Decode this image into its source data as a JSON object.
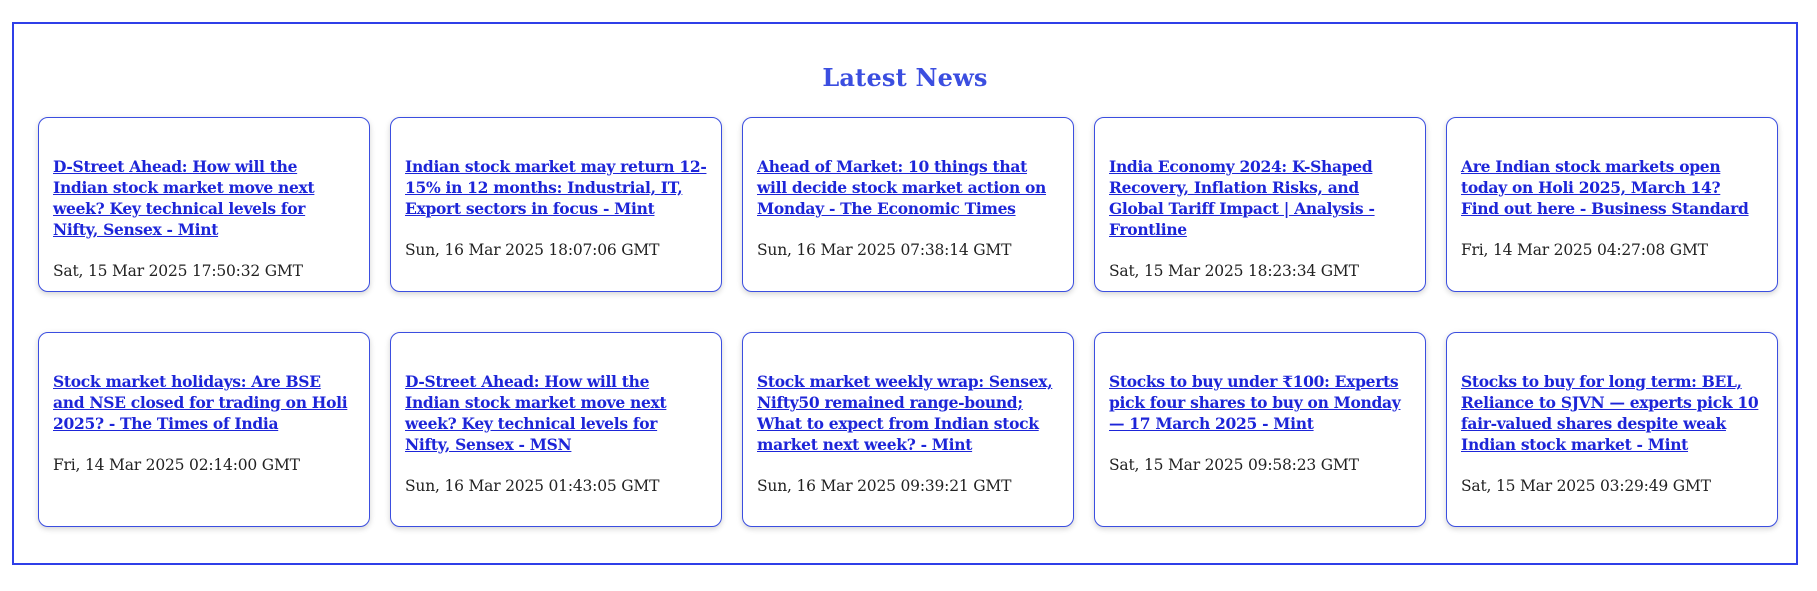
{
  "section": {
    "title": "Latest News"
  },
  "news": {
    "items": [
      {
        "title": "D-Street Ahead: How will the Indian stock market move next week? Key technical levels for Nifty, Sensex - Mint",
        "date": "Sat, 15 Mar 2025 17:50:32 GMT"
      },
      {
        "title": "Indian stock market may return 12-15% in 12 months: Industrial, IT, Export sectors in focus - Mint",
        "date": "Sun, 16 Mar 2025 18:07:06 GMT"
      },
      {
        "title": "Ahead of Market: 10 things that will decide stock market action on Monday - The Economic Times",
        "date": "Sun, 16 Mar 2025 07:38:14 GMT"
      },
      {
        "title": "India Economy 2024: K-Shaped Recovery, Inflation Risks, and Global Tariff Impact | Analysis - Frontline",
        "date": "Sat, 15 Mar 2025 18:23:34 GMT"
      },
      {
        "title": "Are Indian stock markets open today on Holi 2025, March 14? Find out here - Business Standard",
        "date": "Fri, 14 Mar 2025 04:27:08 GMT"
      },
      {
        "title": "Stock market holidays: Are BSE and NSE closed for trading on Holi 2025? - The Times of India",
        "date": "Fri, 14 Mar 2025 02:14:00 GMT"
      },
      {
        "title": "D-Street Ahead: How will the Indian stock market move next week? Key technical levels for Nifty, Sensex - MSN",
        "date": "Sun, 16 Mar 2025 01:43:05 GMT"
      },
      {
        "title": "Stock market weekly wrap: Sensex, Nifty50 remained range-bound; What to expect from Indian stock market next week? - Mint",
        "date": "Sun, 16 Mar 2025 09:39:21 GMT"
      },
      {
        "title": "Stocks to buy under ₹100: Experts pick four shares to buy on Monday — 17 March 2025 - Mint",
        "date": "Sat, 15 Mar 2025 09:58:23 GMT"
      },
      {
        "title": "Stocks to buy for long term: BEL, Reliance to SJVN — experts pick 10 fair-valued shares despite weak Indian stock market - Mint",
        "date": "Sat, 15 Mar 2025 03:29:49 GMT"
      }
    ]
  },
  "colors": {
    "accent": "#3b4ee0",
    "link": "#1d25d8",
    "border": "#2f3fe8",
    "text": "#222222",
    "background": "#ffffff"
  }
}
